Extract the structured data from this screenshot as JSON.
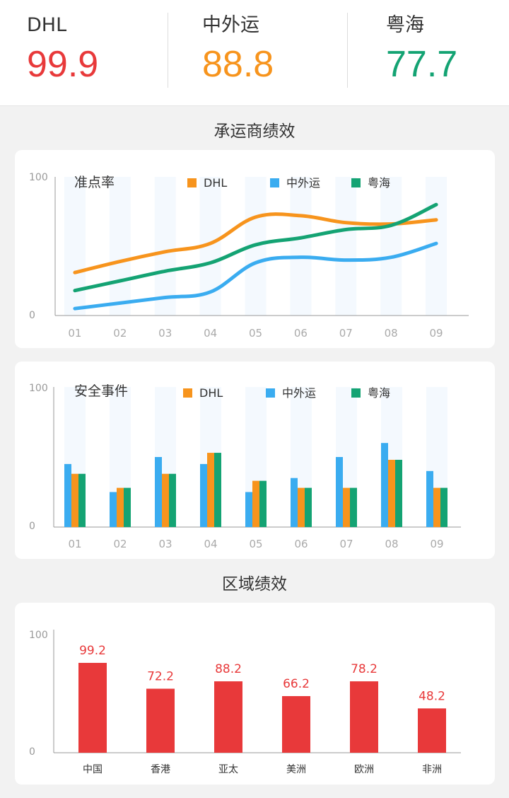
{
  "kpis": [
    {
      "name": "DHL",
      "value": "99.9",
      "color": "#e8393a"
    },
    {
      "name": "中外运",
      "value": "88.8",
      "color": "#f7941d"
    },
    {
      "name": "粤海",
      "value": "77.7",
      "color": "#14a373"
    }
  ],
  "section1": {
    "title": "承运商绩效"
  },
  "section2": {
    "title": "区域绩效"
  },
  "legend_colors": {
    "DHL": "#f7941d",
    "中外运": "#3aacf0",
    "粤海": "#14a373"
  },
  "chart_data": [
    {
      "type": "line",
      "title": "准点率",
      "x": [
        "01",
        "02",
        "03",
        "04",
        "05",
        "06",
        "07",
        "08",
        "09"
      ],
      "ylim": [
        0,
        100
      ],
      "yticks": [
        "0",
        "100"
      ],
      "series": [
        {
          "name": "DHL",
          "color": "#f7941d",
          "values": [
            31,
            39,
            46,
            52,
            71,
            72,
            67,
            66,
            69
          ]
        },
        {
          "name": "中外运",
          "color": "#3aacf0",
          "values": [
            5,
            9,
            13,
            17,
            38,
            42,
            40,
            42,
            52
          ]
        },
        {
          "name": "粤海",
          "color": "#14a373",
          "values": [
            18,
            25,
            32,
            38,
            51,
            56,
            62,
            65,
            80
          ]
        }
      ]
    },
    {
      "type": "bar",
      "title": "安全事件",
      "categories": [
        "01",
        "02",
        "03",
        "04",
        "05",
        "06",
        "07",
        "08",
        "09"
      ],
      "ylim": [
        0,
        100
      ],
      "yticks": [
        "0",
        "100"
      ],
      "series": [
        {
          "name": "中外运",
          "color": "#3aacf0",
          "values": [
            45,
            25,
            50,
            45,
            25,
            35,
            50,
            60,
            40
          ]
        },
        {
          "name": "DHL",
          "color": "#f7941d",
          "values": [
            38,
            28,
            38,
            53,
            33,
            28,
            28,
            48,
            28
          ]
        },
        {
          "name": "粤海",
          "color": "#14a373",
          "values": [
            38,
            28,
            38,
            53,
            33,
            28,
            28,
            48,
            28
          ]
        }
      ],
      "legend_order": [
        "DHL",
        "中外运",
        "粤海"
      ]
    },
    {
      "type": "bar",
      "categories": [
        "中国",
        "香港",
        "亚太",
        "美洲",
        "欧洲",
        "非洲"
      ],
      "values": [
        73,
        52,
        58,
        46,
        58,
        36
      ],
      "data_labels": [
        "99.2",
        "72.2",
        "88.2",
        "66.2",
        "78.2",
        "48.2"
      ],
      "color": "#e8393a",
      "ylim": [
        0,
        100
      ],
      "yticks": [
        "0",
        "100"
      ]
    }
  ]
}
